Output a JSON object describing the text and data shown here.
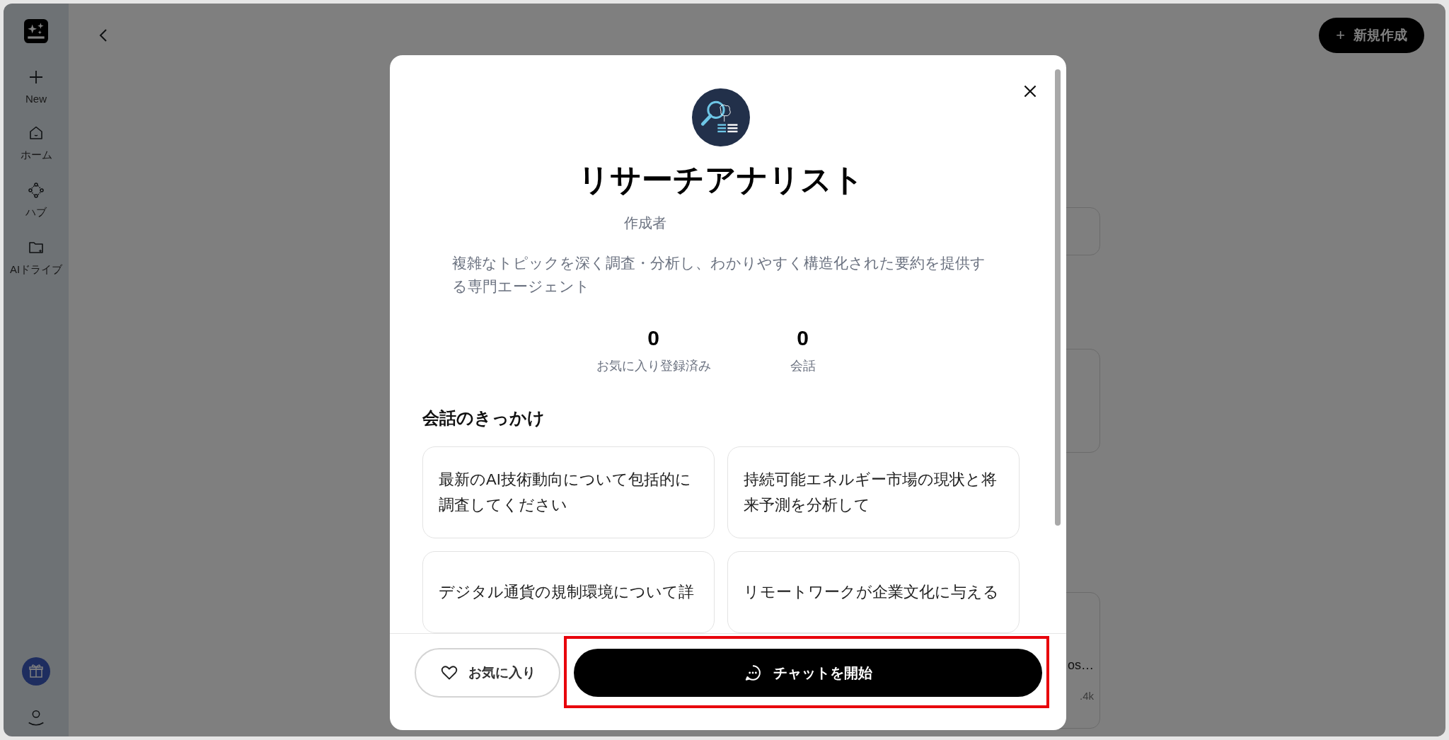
{
  "sidebar": {
    "items": [
      {
        "kind": "new",
        "label": "New"
      },
      {
        "kind": "home",
        "label": "ホーム"
      },
      {
        "kind": "hub",
        "label": "ハブ"
      },
      {
        "kind": "drive",
        "label": "AIドライブ"
      }
    ]
  },
  "header": {
    "new_button": {
      "icon": "+",
      "label": "新規作成"
    }
  },
  "background": {
    "cards": [
      {
        "kind": "short"
      },
      {
        "kind": "medium"
      },
      {
        "kind": "tall",
        "title": "os…",
        "meta": ".4k"
      }
    ]
  },
  "modal": {
    "title": "リサーチアナリスト",
    "author_label": "作成者",
    "description": "複雑なトピックを深く調査・分析し、わかりやすく構造化された要約を提供する専門エージェント",
    "stats": [
      {
        "value": "0",
        "label": "お気に入り登録済み"
      },
      {
        "value": "0",
        "label": "会話"
      }
    ],
    "starters_heading": "会話のきっかけ",
    "starters": [
      "最新のAI技術動向について包括的に調査してください",
      "持続可能エネルギー市場の現状と将来予測を分析して",
      "デジタル通貨の規制環境について詳",
      "リモートワークが企業文化に与える"
    ],
    "favorite_button": {
      "label": "お気に入り",
      "selected": false
    },
    "chat_button": {
      "label": "チャットを開始",
      "highlighted": true
    }
  }
}
